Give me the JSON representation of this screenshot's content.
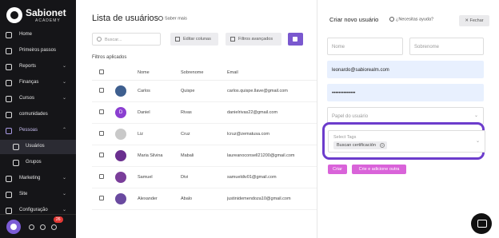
{
  "brand": {
    "name": "Sabionet",
    "sub": "ACADEMY"
  },
  "sidebar": {
    "items": [
      {
        "label": "Home",
        "icon": "home-icon"
      },
      {
        "label": "Primeiros passos",
        "icon": "rocket-icon"
      },
      {
        "label": "Reports",
        "icon": "chart-icon",
        "chevron": "⌄"
      },
      {
        "label": "Finanças",
        "icon": "money-icon",
        "chevron": "⌄"
      },
      {
        "label": "Cursos",
        "icon": "book-icon",
        "chevron": "⌄"
      },
      {
        "label": "comunidades",
        "icon": "community-icon"
      },
      {
        "label": "Pessoas",
        "icon": "people-icon",
        "chevron": "⌃"
      },
      {
        "label": "Usuários",
        "icon": "user-icon"
      },
      {
        "label": "Grupos",
        "icon": "group-icon"
      },
      {
        "label": "Marketing",
        "icon": "megaphone-icon",
        "chevron": "⌄"
      },
      {
        "label": "Site",
        "icon": "grid-icon",
        "chevron": "⌄"
      },
      {
        "label": "Configuração",
        "icon": "settings-icon",
        "chevron": "⌄"
      }
    ],
    "badge": "26"
  },
  "main": {
    "title": "Lista de usuários",
    "saber_mais": "Saber mais",
    "search_placeholder": "Buscar...",
    "edit_columns": "Editar colunas",
    "advanced_filters": "Filtros avançados",
    "applied_filters": "Filtros aplicados",
    "columns": [
      "Nome",
      "Sobrenome",
      "Email"
    ],
    "rows": [
      {
        "first": "Carlos",
        "last": "Quispe",
        "email": "carlos.quispe.llave@gmail.com",
        "avatar_color": "#3e5f8f",
        "initial": ""
      },
      {
        "first": "Daniel",
        "last": "Rivas",
        "email": "danielrivas22@gmail.com",
        "avatar_color": "#8b3fd1",
        "initial": "D"
      },
      {
        "first": "Liz",
        "last": "Cruz",
        "email": "lcruz@zematusa.com",
        "avatar_color": "#c9c9c9",
        "initial": ""
      },
      {
        "first": "Maria Silvina",
        "last": "Mabali",
        "email": "laureanoconsell21200@gmail.com",
        "avatar_color": "#6a2f8f",
        "initial": ""
      },
      {
        "first": "Samuel",
        "last": "Divi",
        "email": "samueldiv01@gmail.com",
        "avatar_color": "#7a3e9a",
        "initial": ""
      },
      {
        "first": "Alexander",
        "last": "Abalo",
        "email": "justinidemendoza10@gmail.com",
        "avatar_color": "#6a4aa0",
        "initial": ""
      }
    ]
  },
  "panel": {
    "title": "Criar novo usuário",
    "help": "¿Necesitas ayuda?",
    "close": "Fechar",
    "name_placeholder": "Nome",
    "lastname_placeholder": "Sobrenome",
    "email_value": "leonardo@sabiorealm.com",
    "password_value": "••••••••••••••",
    "role_placeholder": "Papel do usuário",
    "tags_placeholder": "Select Tags",
    "tag_chip": "Buscan certificación",
    "create": "Criar",
    "create_add": "Crie e adicione outra"
  },
  "colors": {
    "accent": "#7a58cf",
    "highlight": "#6c3ccc",
    "pink": "#d963d9"
  }
}
